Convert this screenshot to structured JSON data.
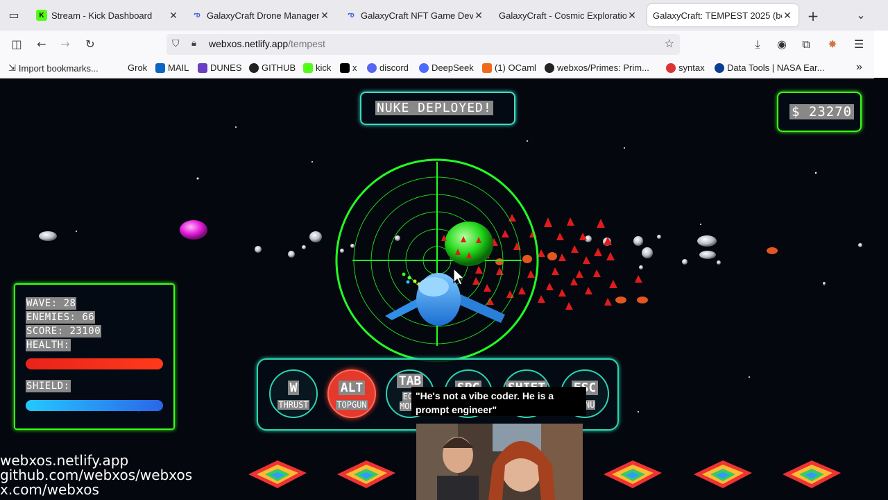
{
  "browser": {
    "tabs": [
      {
        "title": "Stream - Kick Dashboard",
        "active": false
      },
      {
        "title": "GalaxyCraft Drone Managem",
        "active": false
      },
      {
        "title": "GalaxyCraft NFT Game Deve",
        "active": false
      },
      {
        "title": "GalaxyCraft - Cosmic Exploratio",
        "active": false
      },
      {
        "title": "GalaxyCraft: TEMPEST 2025 (be",
        "active": true
      }
    ],
    "url_domain": "webxos.netlify.app",
    "url_path": "/tempest",
    "bookmarks": [
      "Import bookmarks...",
      "Grok",
      "MAIL",
      "DUNES",
      "GITHUB",
      "kick",
      "x",
      "discord",
      "DeepSeek",
      "(1) OCaml",
      "webxos/Primes: Prim...",
      "syntax",
      "Data Tools | NASA Ear..."
    ]
  },
  "hud": {
    "banner": "NUKE DEPLOYED!",
    "money": "$ 23270",
    "wave": "WAVE: 28",
    "enemies": "ENEMIES: 66",
    "score": "SCORE: 23100",
    "health_label": "HEALTH:",
    "shield_label": "SHIELD:",
    "health_fraction": 1.0,
    "shield_fraction": 1.0
  },
  "controls": [
    {
      "key": "W",
      "label": "THRUST",
      "active": false
    },
    {
      "key": "ALT",
      "label": "TOPGUN",
      "active": true
    },
    {
      "key": "TAB",
      "label": "ECO MODE",
      "active": false
    },
    {
      "key": "SPC",
      "label": "",
      "active": false
    },
    {
      "key": "SHIFT",
      "label": "",
      "active": false
    },
    {
      "key": "ESC",
      "label": "MENU",
      "active": false
    }
  ],
  "overlay": {
    "caption": "\"He's not a vibe coder. He is a prompt engineer\""
  },
  "links": [
    "webxos.netlify.app",
    "github.com/webxos/webxos",
    "x.com/webxos"
  ],
  "colors": {
    "neon_green": "#39ff14",
    "teal": "#2bd6b0",
    "health": "#e8231a",
    "shield": "#2aa6f0",
    "enemy": "#e01b1b"
  }
}
